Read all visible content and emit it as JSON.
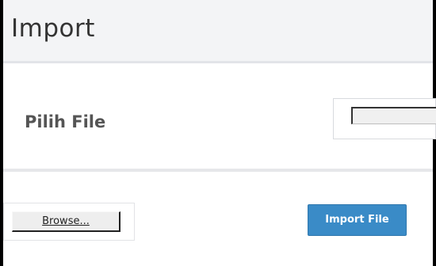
{
  "panel": {
    "title": "Import"
  },
  "form": {
    "file_label": "Pilih File",
    "file_value": ""
  },
  "actions": {
    "browse_label": "Browse...",
    "import_label": "Import File"
  },
  "colors": {
    "header_bg": "#f3f4f6",
    "primary_button": "#3a8bc7",
    "text": "#333333"
  }
}
